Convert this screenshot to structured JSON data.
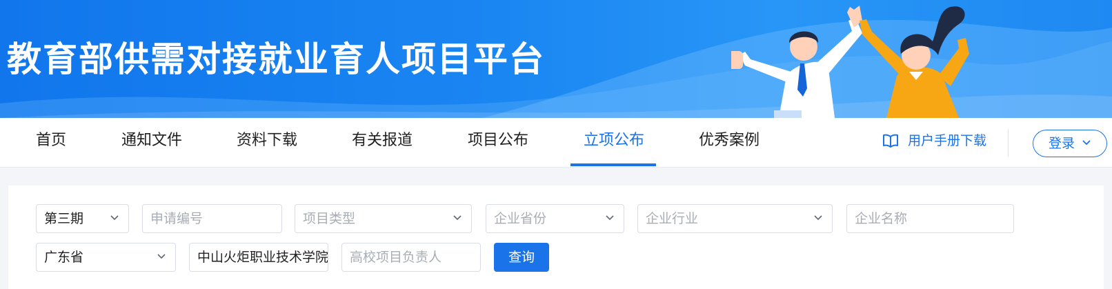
{
  "banner": {
    "title": "教育部供需对接就业育人项目平台"
  },
  "nav": {
    "items": [
      {
        "label": "首页",
        "active": false
      },
      {
        "label": "通知文件",
        "active": false
      },
      {
        "label": "资料下载",
        "active": false
      },
      {
        "label": "有关报道",
        "active": false
      },
      {
        "label": "项目公布",
        "active": false
      },
      {
        "label": "立项公布",
        "active": true
      },
      {
        "label": "优秀案例",
        "active": false
      }
    ],
    "manual_label": "用户手册下载",
    "login_label": "登录"
  },
  "filters": {
    "period": {
      "value": "第三期"
    },
    "application_no": {
      "placeholder": "申请编号"
    },
    "project_type": {
      "placeholder": "项目类型"
    },
    "company_province": {
      "placeholder": "企业省份"
    },
    "company_industry": {
      "placeholder": "企业行业"
    },
    "company_name": {
      "placeholder": "企业名称"
    },
    "school_province": {
      "value": "广东省"
    },
    "school_name": {
      "value": "中山火炬职业技术学院"
    },
    "school_leader": {
      "placeholder": "高校项目负责人"
    },
    "query_label": "查询"
  },
  "colors": {
    "accent": "#1a73e8",
    "banner": "#1a86f2"
  }
}
